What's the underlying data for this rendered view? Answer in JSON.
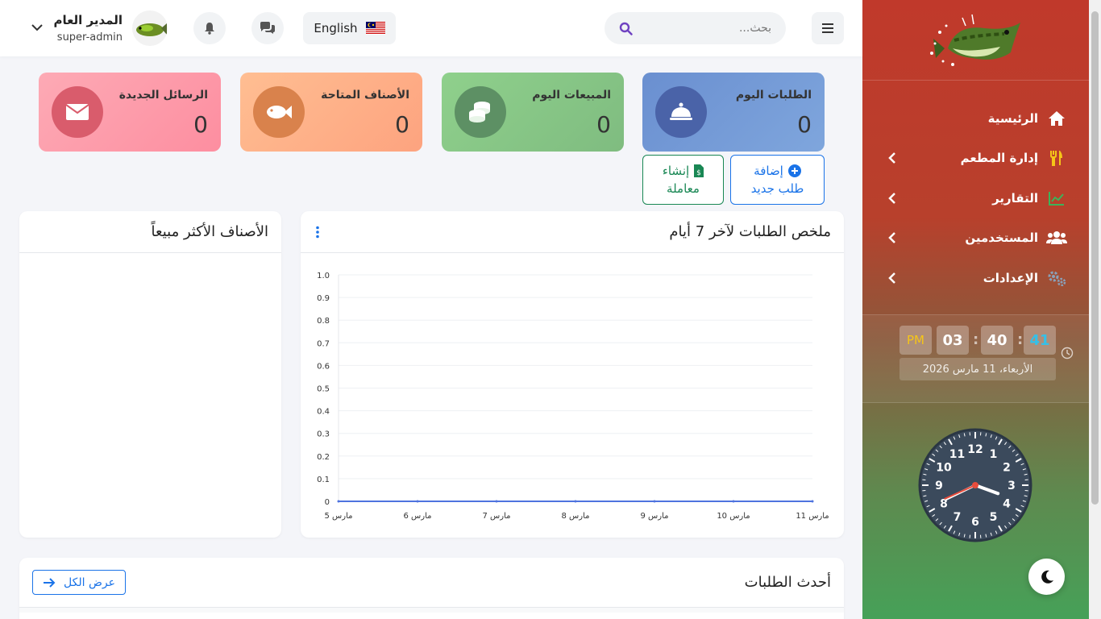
{
  "topbar": {
    "search_placeholder": "بحث...",
    "language_label": "English",
    "user": {
      "name": "المدير العام",
      "role": "super-admin"
    }
  },
  "stats": [
    {
      "title": "الطلبات اليوم",
      "value": "0",
      "bg": "#7a9fd6",
      "icon_bg": "#4a63a8",
      "icon": "bell-icon"
    },
    {
      "title": "المبيعات اليوم",
      "value": "0",
      "bg": "#8fd08c",
      "icon_bg": "#5d9064",
      "icon": "coins-icon"
    },
    {
      "title": "الأصناف المتاحة",
      "value": "0",
      "bg": "#fdb08a",
      "icon_bg": "#d9824c",
      "icon": "fish-icon"
    },
    {
      "title": "الرسائل الجديدة",
      "value": "0",
      "bg": "#fd9fae",
      "icon_bg": "#d95c6c",
      "icon": "envelope-icon"
    }
  ],
  "actions": {
    "add_order": {
      "line1": "إضافة",
      "line2": "طلب جديد"
    },
    "create_transaction": {
      "line1": "إنشاء",
      "line2": "معاملة"
    }
  },
  "cards": {
    "orders_summary_title": "ملخص الطلبات لآخر 7 أيام",
    "top_items_title": "الأصناف الأكثر مبيعاً",
    "latest_orders_title": "أحدث الطلبات",
    "view_all_label": "عرض الكل"
  },
  "chart_data": {
    "type": "line",
    "x": [
      "5 مارس",
      "6 مارس",
      "7 مارس",
      "8 مارس",
      "9 مارس",
      "10 مارس",
      "11 مارس"
    ],
    "series": [
      {
        "values": [
          0,
          0,
          0,
          0,
          0,
          0,
          0
        ]
      }
    ],
    "ylim": [
      0,
      1
    ],
    "yticks": [
      "0",
      "0.1",
      "0.2",
      "0.3",
      "0.4",
      "0.5",
      "0.6",
      "0.7",
      "0.8",
      "0.9",
      "1.0"
    ],
    "grid": true,
    "line_color": "#4e73df"
  },
  "sidebar": {
    "items": [
      {
        "label": "الرئيسية",
        "icon": "home-icon",
        "has_arrow": false
      },
      {
        "label": "إدارة المطعم",
        "icon": "utensils-icon",
        "has_arrow": true
      },
      {
        "label": "التقارير",
        "icon": "chart-line-icon",
        "has_arrow": true
      },
      {
        "label": "المستخدمين",
        "icon": "users-icon",
        "has_arrow": true
      },
      {
        "label": "الإعدادات",
        "icon": "cogs-icon",
        "has_arrow": true
      }
    ],
    "clock": {
      "hours": "03",
      "minutes": "40",
      "seconds": "41",
      "ampm": "PM",
      "date": "الأربعاء، 11 مارس 2026"
    }
  },
  "analog_clock": {
    "hour_hand_hours": 3.67,
    "minute_hand_minutes": 40.7,
    "second_hand_seconds": 41
  },
  "colors": {
    "accent_blue": "#1a73e8",
    "green": "#198754",
    "sidebar_top": "#c0392b",
    "sidebar_bottom": "#46a158"
  }
}
